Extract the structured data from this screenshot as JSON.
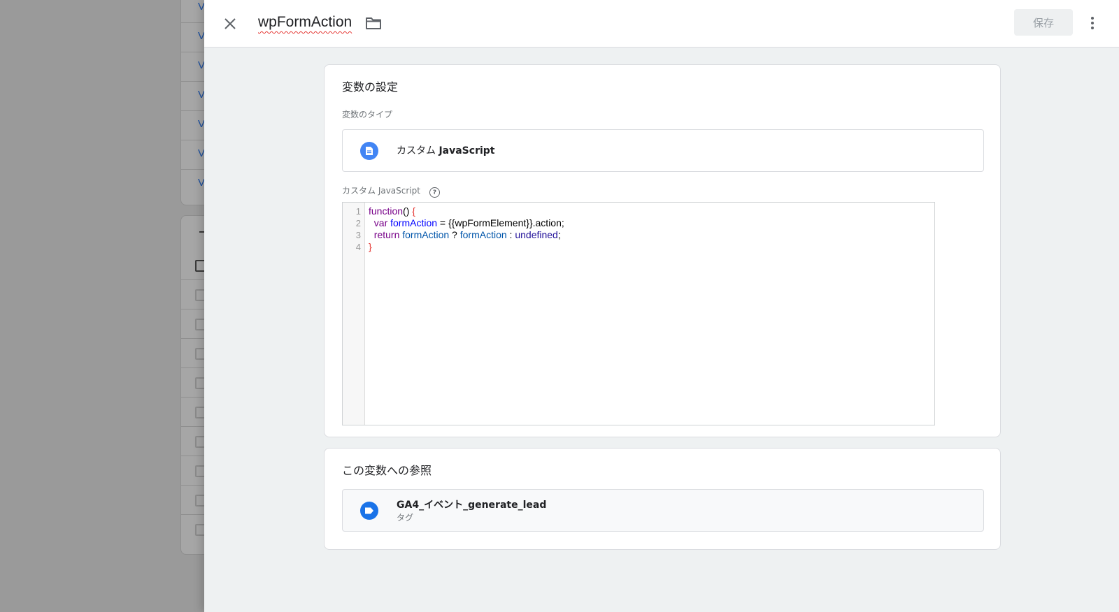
{
  "header": {
    "title": "wpFormAction",
    "save_label": "保存"
  },
  "config_card": {
    "title": "変数の設定",
    "type_label": "変数のタイプ",
    "type_prefix": "カスタム",
    "type_name": "JavaScript",
    "code_label": "カスタム JavaScript"
  },
  "code": {
    "line_numbers": [
      "1",
      "2",
      "3",
      "4"
    ],
    "lines": [
      "function() {",
      "  var formAction = {{wpFormElement}}.action;",
      "  return formAction ? formAction : undefined;",
      "}"
    ]
  },
  "refs_card": {
    "title": "この変数への参照",
    "items": [
      {
        "name": "GA4_イベント_generate_lead",
        "type": "タグ"
      }
    ]
  },
  "background": {
    "link_letter": "V",
    "row_count": 6
  },
  "colors": {
    "accent": "#1a73e8",
    "type_icon": "#4285f4",
    "overlay": "#9e9e9e"
  }
}
